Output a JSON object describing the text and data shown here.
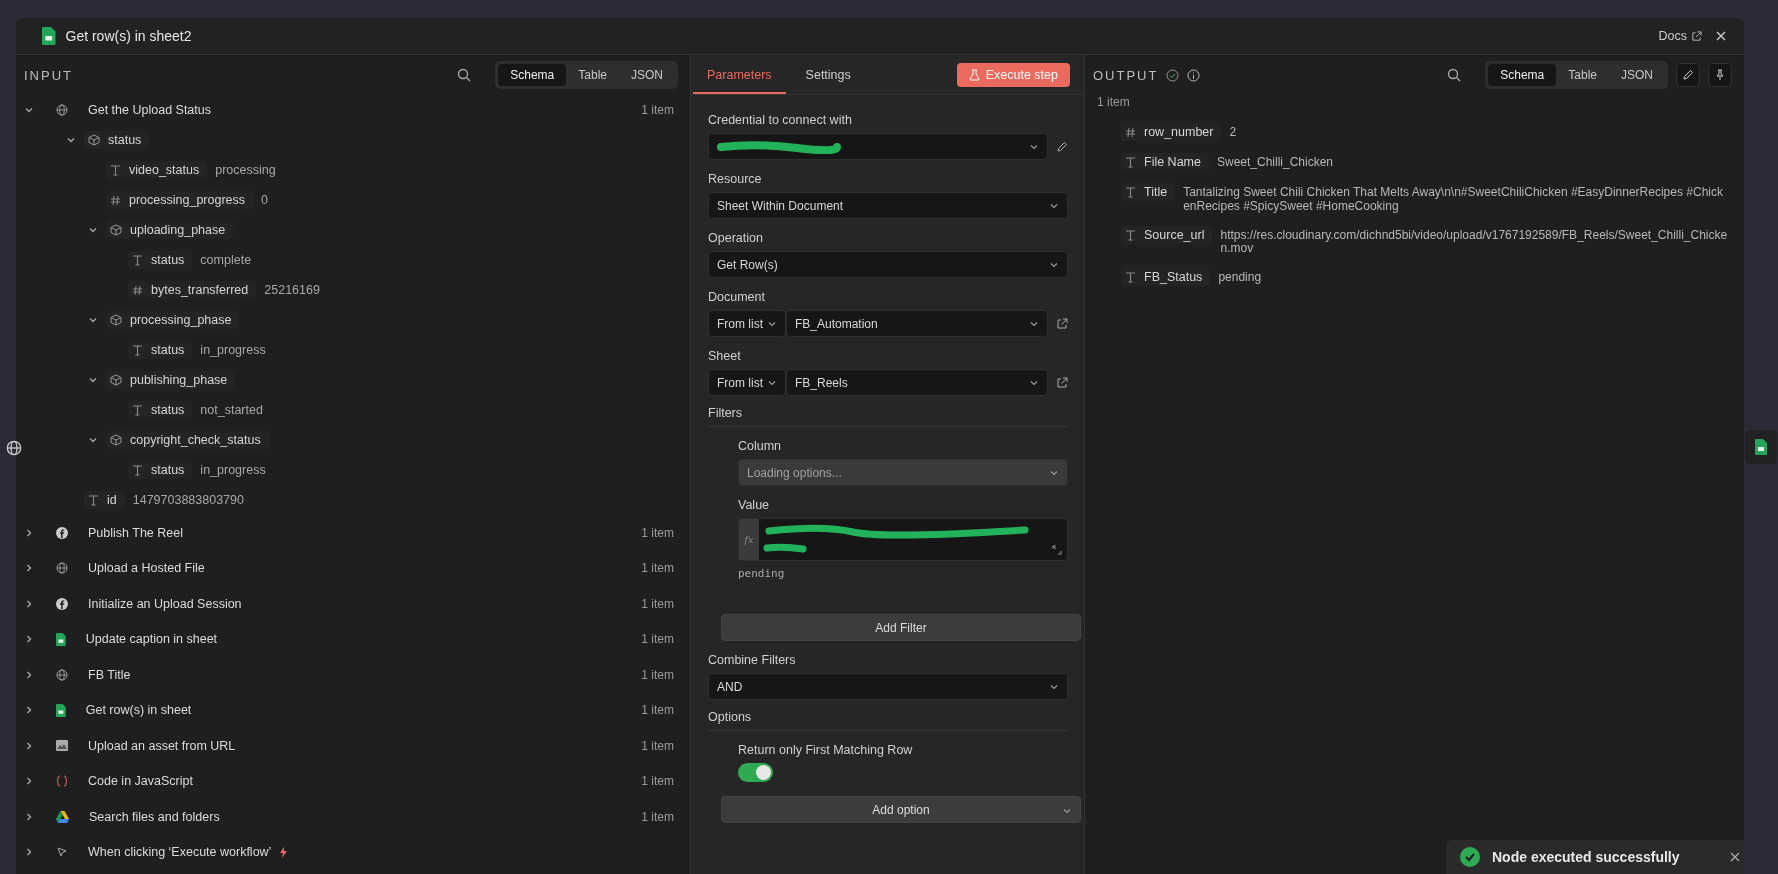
{
  "window": {
    "title": "Get row(s) in sheet2",
    "docs": "Docs"
  },
  "input": {
    "title": "INPUT",
    "views": [
      {
        "label": "Schema",
        "selected": true
      },
      {
        "label": "Table",
        "selected": false
      },
      {
        "label": "JSON",
        "selected": false
      }
    ],
    "nodes": [
      {
        "name": "Get the Upload Status",
        "kind": "globe",
        "count": "1 item",
        "expanded": true,
        "fields": [
          {
            "kind": "object",
            "name": "status",
            "expanded": true,
            "children": [
              {
                "kind": "string",
                "name": "video_status",
                "value": "processing"
              },
              {
                "kind": "number",
                "name": "processing_progress",
                "value": "0"
              },
              {
                "kind": "object",
                "name": "uploading_phase",
                "expanded": true,
                "children": [
                  {
                    "kind": "string",
                    "name": "status",
                    "value": "complete"
                  },
                  {
                    "kind": "number",
                    "name": "bytes_transferred",
                    "value": "25216169"
                  }
                ]
              },
              {
                "kind": "object",
                "name": "processing_phase",
                "expanded": true,
                "children": [
                  {
                    "kind": "string",
                    "name": "status",
                    "value": "in_progress"
                  }
                ]
              },
              {
                "kind": "object",
                "name": "publishing_phase",
                "expanded": true,
                "children": [
                  {
                    "kind": "string",
                    "name": "status",
                    "value": "not_started"
                  }
                ]
              },
              {
                "kind": "object",
                "name": "copyright_check_status",
                "expanded": true,
                "children": [
                  {
                    "kind": "string",
                    "name": "status",
                    "value": "in_progress"
                  }
                ]
              }
            ]
          },
          {
            "kind": "string",
            "name": "id",
            "value": "1479703883803790"
          }
        ]
      },
      {
        "name": "Publish The Reel",
        "kind": "facebook",
        "count": "1 item",
        "expanded": false
      },
      {
        "name": "Upload a Hosted File",
        "kind": "globe",
        "count": "1 item",
        "expanded": false
      },
      {
        "name": "Initialize an Upload Session",
        "kind": "facebook",
        "count": "1 item",
        "expanded": false
      },
      {
        "name": "Update caption in sheet",
        "kind": "sheets",
        "count": "1 item",
        "expanded": false
      },
      {
        "name": "FB Title",
        "kind": "globe",
        "count": "1 item",
        "expanded": false
      },
      {
        "name": "Get row(s) in sheet",
        "kind": "sheets",
        "count": "1 item",
        "expanded": false
      },
      {
        "name": "Upload an asset from URL",
        "kind": "image",
        "count": "1 item",
        "expanded": false
      },
      {
        "name": "Code in JavaScript",
        "kind": "code",
        "count": "1 item",
        "expanded": false
      },
      {
        "name": "Search files and folders",
        "kind": "drive",
        "count": "1 item",
        "expanded": false
      },
      {
        "name": "When clicking ‘Execute workflow’",
        "kind": "trigger",
        "expanded": false
      }
    ]
  },
  "parameters": {
    "tabs": [
      {
        "label": "Parameters",
        "selected": true
      },
      {
        "label": "Settings",
        "selected": false
      }
    ],
    "execute": "Execute step",
    "fields": [
      {
        "kind": "credential",
        "label": "Credential to connect with"
      },
      {
        "kind": "select",
        "label": "Resource",
        "value": "Sheet Within Document"
      },
      {
        "kind": "select",
        "label": "Operation",
        "value": "Get Row(s)"
      },
      {
        "kind": "locator",
        "label": "Document",
        "mode": "From list",
        "value": "FB_Automation"
      },
      {
        "kind": "locator",
        "label": "Sheet",
        "mode": "From list",
        "value": "FB_Reels"
      },
      {
        "kind": "filters",
        "label": "Filters",
        "column_label": "Column",
        "column_placeholder": "Loading options...",
        "value_label": "Value",
        "badge": "fx",
        "hint": "pending",
        "button": "Add Filter"
      },
      {
        "kind": "select",
        "label": "Combine Filters",
        "value": "AND"
      },
      {
        "kind": "options",
        "label": "Options",
        "toggle_label": "Return only First Matching Row",
        "on": true,
        "button": "Add option"
      }
    ]
  },
  "output": {
    "title": "OUTPUT",
    "count": "1 item",
    "views": [
      {
        "label": "Schema",
        "selected": true
      },
      {
        "label": "Table",
        "selected": false
      },
      {
        "label": "JSON",
        "selected": false
      }
    ],
    "fields": [
      {
        "kind": "number",
        "name": "row_number",
        "value": "2"
      },
      {
        "kind": "string",
        "name": "File Name",
        "value": "Sweet_Chilli_Chicken"
      },
      {
        "kind": "string",
        "name": "Title",
        "value": "Tantalizing Sweet Chili Chicken That Melts Away\\n\\n#SweetChiliChicken #EasyDinnerRecipes #ChickenRecipes #SpicySweet #HomeCooking"
      },
      {
        "kind": "string",
        "name": "Source_url",
        "value": "https://res.cloudinary.com/dichnd5bi/video/upload/v1767192589/FB_Reels/Sweet_Chilli_Chicken.mov"
      },
      {
        "kind": "string",
        "name": "FB_Status",
        "value": "pending"
      }
    ]
  },
  "toast": {
    "message": "Node executed successfully"
  }
}
